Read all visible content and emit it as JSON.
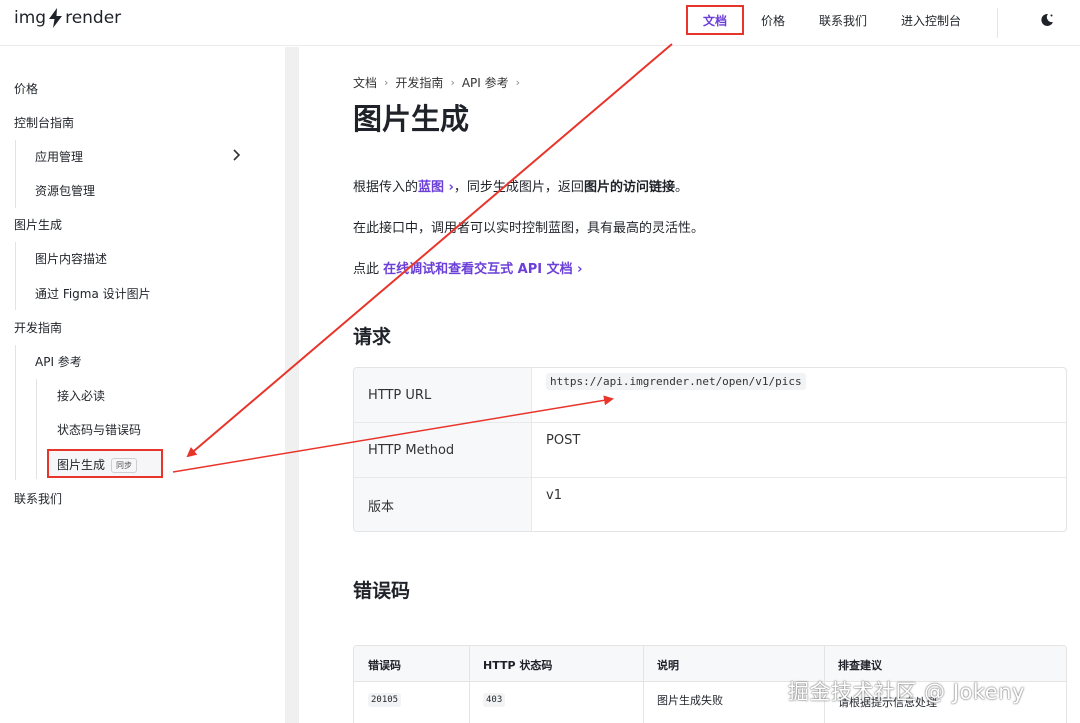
{
  "header": {
    "logo_left": "img",
    "logo_right": "render",
    "nav": [
      "文档",
      "价格",
      "联系我们",
      "进入控制台"
    ],
    "active_nav": "文档"
  },
  "sidebar": {
    "pricing": "价格",
    "console_guide": "控制台指南",
    "app_manage": "应用管理",
    "package_manage": "资源包管理",
    "image_gen": "图片生成",
    "image_desc": "图片内容描述",
    "figma_design": "通过 Figma 设计图片",
    "dev_guide": "开发指南",
    "api_ref": "API 参考",
    "must_read": "接入必读",
    "status_codes": "状态码与错误码",
    "active_item": "图片生成",
    "active_badge": "同步",
    "contact": "联系我们"
  },
  "breadcrumb": [
    "文档",
    "开发指南",
    "API 参考"
  ],
  "main": {
    "title": "图片生成",
    "p1_pre": "根据传入的",
    "p1_link": "蓝图",
    "p1_mid": "，同步生成图片，返回",
    "p1_strong": "图片的访问链接",
    "p1_end": "。",
    "p2": "在此接口中，调用者可以实时控制蓝图，具有最高的灵活性。",
    "p3_pre": "点此",
    "p3_link": "在线调试和查看交互式 API 文档",
    "request_heading": "请求",
    "request_rows": [
      {
        "key": "HTTP URL",
        "value": "https://api.imgrender.net/open/v1/pics"
      },
      {
        "key": "HTTP Method",
        "value": "POST"
      },
      {
        "key": "版本",
        "value": "v1"
      }
    ],
    "errors_heading": "错误码",
    "error_headers": [
      "错误码",
      "HTTP 状态码",
      "说明",
      "排查建议"
    ],
    "error_rows": [
      {
        "code": "20105",
        "http": "403",
        "desc": "图片生成失败",
        "advice": "请根据提示信息处理"
      }
    ]
  },
  "watermark": "掘金技术社区 @ Jokeny",
  "colors": {
    "accent": "#6b3fd8",
    "annotation": "#e8352b"
  }
}
